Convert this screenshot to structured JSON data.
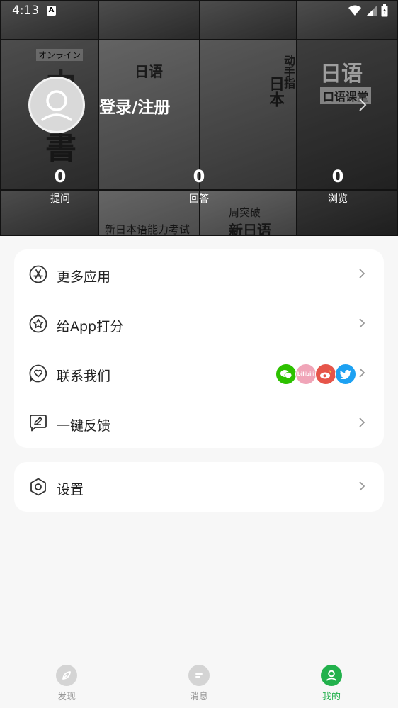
{
  "status_bar": {
    "time": "4:13",
    "badge": "A"
  },
  "header": {
    "login_label": "登录/注册",
    "collage": {
      "tile_texts": [
        "オンライン",
        "中日書",
        "日语",
        "日本",
        "动手指",
        "日语",
        "口语课堂",
        "新日本语能力考试",
        "周突破",
        "新日语"
      ]
    },
    "stats": [
      {
        "value": "0",
        "label": "提问"
      },
      {
        "value": "0",
        "label": "回答"
      },
      {
        "value": "0",
        "label": "浏览"
      }
    ]
  },
  "menu": [
    {
      "label": "更多应用",
      "icon": "app-store-icon"
    },
    {
      "label": "给App打分",
      "icon": "star-badge-icon"
    },
    {
      "label": "联系我们",
      "icon": "heart-chat-icon",
      "socials": [
        "wechat-icon",
        "bilibili-icon",
        "weibo-icon",
        "twitter-icon"
      ],
      "bilibili_text": "bilibili"
    },
    {
      "label": "一键反馈",
      "icon": "feedback-icon"
    }
  ],
  "settings": {
    "label": "设置",
    "icon": "hexagon-settings-icon"
  },
  "bottom_nav": [
    {
      "label": "发现",
      "active": false
    },
    {
      "label": "消息",
      "active": false
    },
    {
      "label": "我的",
      "active": true
    }
  ],
  "colors": {
    "accent": "#22b14c",
    "inactive": "#999999",
    "wechat": "#2dc100",
    "bilibili": "#f0a5b8",
    "weibo": "#e6554a",
    "twitter": "#1da1f2"
  }
}
